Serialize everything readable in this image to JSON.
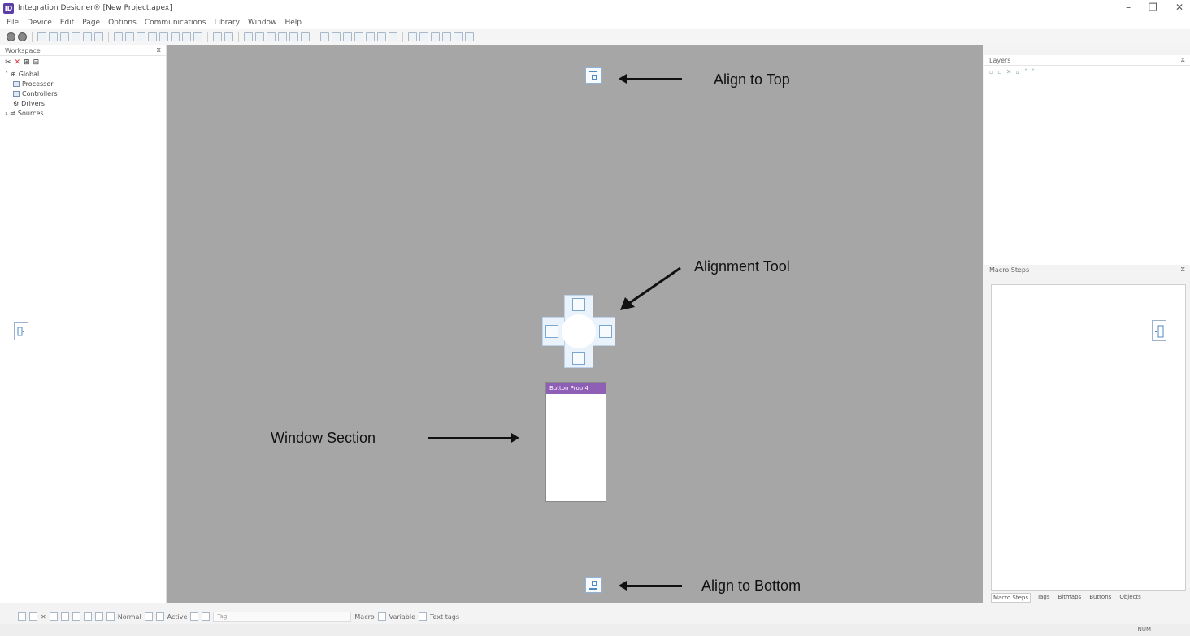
{
  "window": {
    "title": "Integration Designer® [New Project.apex]",
    "logo": "ID",
    "controls": [
      "–",
      "❐",
      "✕"
    ]
  },
  "menu": [
    "File",
    "Device",
    "Edit",
    "Page",
    "Options",
    "Communications",
    "Library",
    "Window",
    "Help"
  ],
  "workspace": {
    "title": "Workspace",
    "pin": "⧖",
    "tree": {
      "root": "Global",
      "children": [
        "Processor",
        "Controllers",
        "Drivers",
        "Sources"
      ]
    }
  },
  "canvas": {
    "annotations": {
      "align_top": "Align to Top",
      "alignment_tool": "Alignment Tool",
      "window_section": "Window Section",
      "align_bottom": "Align to Bottom"
    },
    "window_section_title": "Button Prop 4"
  },
  "layers": {
    "title": "Layers",
    "pin": "⧖"
  },
  "macro": {
    "title": "Macro Steps",
    "pin": "⧖",
    "tabs": [
      "Macro Steps",
      "Tags",
      "Bitmaps",
      "Buttons",
      "Objects"
    ]
  },
  "bottom_toolbar": {
    "normal_label": "Normal",
    "active_label": "Active",
    "tag_placeholder": "Tag",
    "macro_label": "Macro",
    "variable_label": "Variable",
    "text_tags_label": "Text tags"
  },
  "status": {
    "right": "NUM"
  }
}
